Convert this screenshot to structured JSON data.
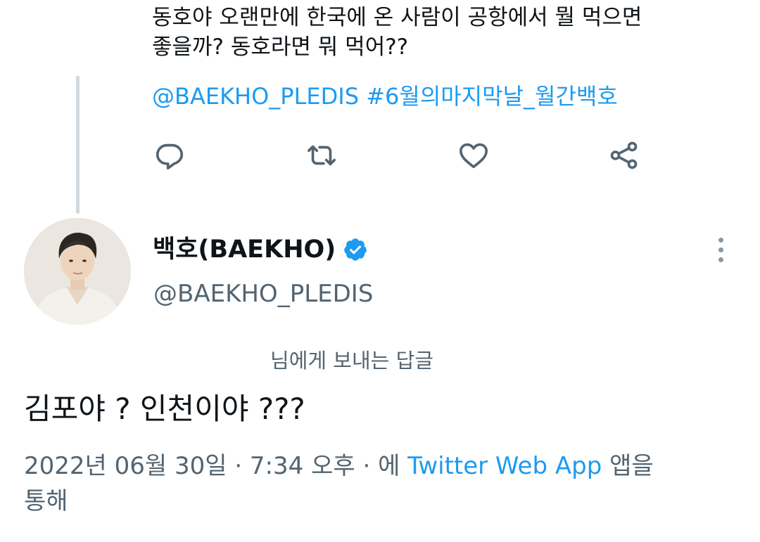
{
  "parent_tweet": {
    "text_lines": [
      "동호야 오랜만에 한국에 온 사람이 공항에서 뭘 먹으면",
      "좋을까? 동호라면 뭐 먹어??"
    ],
    "mention": "@BAEKHO_PLEDIS",
    "hashtag": "#6월의마지막날_월간백호"
  },
  "actions": {
    "reply_icon": "reply-icon",
    "retweet_icon": "retweet-icon",
    "like_icon": "heart-icon",
    "share_icon": "share-icon"
  },
  "tweet": {
    "display_name": "백호(BAEKHO)",
    "verified": true,
    "handle": "@BAEKHO_PLEDIS",
    "reply_to_label": "님에게 보내는 답글",
    "text": "김포야 ? 인천이야 ???",
    "timestamp": "2022년 06월 30일 · 7:34 오후 · 에",
    "via_app": "Twitter Web App",
    "via_suffix_1": "앱을",
    "via_suffix_2": "통해"
  },
  "colors": {
    "accent": "#1d9bf0",
    "secondary_text": "#536471",
    "thread_line": "#cfd9de"
  }
}
